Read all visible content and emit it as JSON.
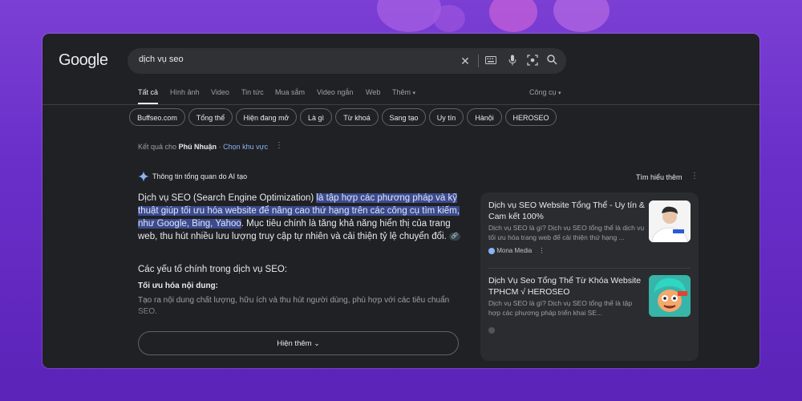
{
  "browser": {
    "logo": "Google",
    "search_query": "dịch vụ seo"
  },
  "tabs": [
    {
      "label": "Tất cả",
      "active": true
    },
    {
      "label": "Hình ảnh"
    },
    {
      "label": "Video"
    },
    {
      "label": "Tin tức"
    },
    {
      "label": "Mua sắm"
    },
    {
      "label": "Video ngắn"
    },
    {
      "label": "Web"
    },
    {
      "label": "Thêm"
    }
  ],
  "tools_label": "Công cụ",
  "chips": [
    "Buffseo.com",
    "Tổng thể",
    "Hiện đang mở",
    "Là gì",
    "Từ khoá",
    "Sang tạo",
    "Uy tín",
    "Hànội",
    "HEROSEO"
  ],
  "location": {
    "prefix": "Kết quả cho",
    "place": "Phú Nhuận",
    "separator": "·",
    "change_link": "Chọn khu vực"
  },
  "ai_overview": {
    "label": "Thông tin tổng quan do AI tạo",
    "learn_more": "Tìm hiểu thêm",
    "paragraph_start": "Dịch vụ SEO (Search Engine Optimization) ",
    "paragraph_highlight": "là tập hợp các phương pháp và kỹ thuật giúp tối ưu hóa website để nâng cao thứ hạng trên các công cụ tìm kiếm, như Google, Bing, Yahoo",
    "paragraph_end": ". Mục tiêu chính là tăng khả năng hiển thị của trang web, thu hút nhiều lưu lượng truy cập tự nhiên và cải thiện tỷ lệ chuyển đổi.",
    "heading": "Các yếu tố chính trong dịch vụ SEO:",
    "subheading": "Tối ưu hóa nội dung:",
    "sub_text": "Tạo ra nội dung chất lượng, hữu ích và thu hút người dùng, phù hợp với các tiêu chuẩn SEO.",
    "show_more": "Hiện thêm"
  },
  "sources": [
    {
      "title": "Dịch vụ SEO Website Tổng Thể - Uy tín & Cam kết 100%",
      "desc": "Dịch vụ SEO là gì? Dịch vụ SEO tổng thể là dịch vụ tối ưu hóa trang web để cải thiện thứ hạng ...",
      "source": "Mona Media"
    },
    {
      "title": "Dịch Vụ Seo Tổng Thể Từ Khóa Website TPHCM √ HEROSEO",
      "desc": "Dịch vụ SEO là gì? Dịch vụ SEO tổng thể là tập hợp các phương pháp triển khai SE...",
      "source": ""
    }
  ],
  "colors": {
    "background": "#6a2fc9",
    "window": "#202124",
    "search_bar": "#303134",
    "text_primary": "#e8eaed",
    "text_secondary": "#9aa0a6",
    "link": "#8ab4f8",
    "highlight": "#3c4b8c"
  }
}
